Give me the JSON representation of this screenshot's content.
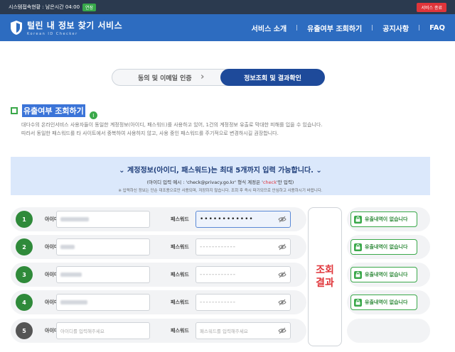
{
  "topbar": {
    "status": "시스템접속현황 : 남은시간 04:00",
    "extend_label": "연장",
    "end_label": "서비스 종료"
  },
  "header": {
    "logo_title": "털린 내 정보 찾기 서비스",
    "logo_sub": "Korean ID Checker",
    "nav": [
      "서비스 소개",
      "유출여부 조회하기",
      "공지사항",
      "FAQ"
    ]
  },
  "steps": {
    "step1": "동의 및 이메일 인증",
    "step2": "정보조회 및 결과확인"
  },
  "section": {
    "title": "유출여부 조회하기",
    "desc1": "대다수의 온라인서비스 사용자들이 동일한 계정정보(아이디, 패스워드)를 사용하고 있어, 1건의 계정정보 유출로 막대한 피해를 입을 수 있습니다.",
    "desc2": "따라서 동일한 패스워드를 타 사이트에서 중복하여 사용하지 않고, 사용 중인 패스워드를 주기적으로 변경하시길 권장합니다."
  },
  "notice": {
    "title": "계정정보(아이디, 패스워드)는 최대 5개까지 입력 가능합니다.",
    "example_prefix": "(아이디 입력 예시 : 'check@privacy.go.kr' 형식 계정은 '",
    "example_red": "check",
    "example_suffix": "'만 입력)",
    "note": "※ 입력하신 정보는 단순 대조용으로만 사용되며, 저장하지 않습니다. 조회 후 즉시 파기되므로 안심하고 사용하시기 바랍니다."
  },
  "form": {
    "id_label": "아이디",
    "pw_label": "패스워드",
    "rows": [
      {
        "num": "1",
        "pw": "••••••••••••"
      },
      {
        "num": "2",
        "pw": "------------"
      },
      {
        "num": "3",
        "pw": "------------"
      },
      {
        "num": "4",
        "pw": "------------"
      },
      {
        "num": "5",
        "id_placeholder": "아이디를 입력해주세요",
        "pw_placeholder": "패스워드를 입력해주세요"
      }
    ],
    "result_button": "조회 결과"
  },
  "results": {
    "no_leak": "유출내역이 없습니다"
  },
  "colors": {
    "header_blue": "#2d6cc0",
    "step_active": "#1e4a9a",
    "green": "#3aa84a",
    "red": "#e0353a",
    "notice_bg": "#dbe8fb"
  }
}
